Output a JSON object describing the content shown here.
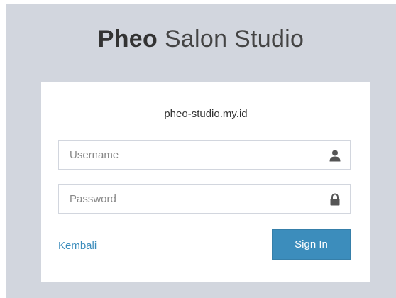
{
  "logo": {
    "bold_text": "Pheo",
    "light_text": "Salon Studio"
  },
  "login_box": {
    "site_label": "pheo-studio.my.id",
    "username": {
      "placeholder": "Username",
      "value": "",
      "icon": "user-icon"
    },
    "password": {
      "placeholder": "Password",
      "value": "",
      "icon": "lock-icon"
    },
    "back_link_label": "Kembali",
    "sign_in_label": "Sign In"
  },
  "colors": {
    "page_background": "#d2d6de",
    "card_background": "#ffffff",
    "accent": "#3c8dbc",
    "icon": "#555555"
  }
}
